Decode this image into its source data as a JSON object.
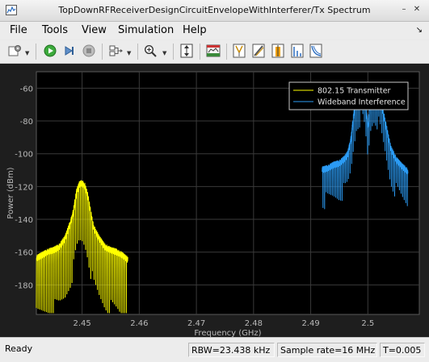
{
  "window": {
    "title": "TopDownRFReceiverDesignCircuitEnvelopeWithInterferer/Tx Spectrum",
    "icon": "scope-window-icon"
  },
  "menu": {
    "items": [
      {
        "label": "File"
      },
      {
        "label": "Tools"
      },
      {
        "label": "View"
      },
      {
        "label": "Simulation"
      },
      {
        "label": "Help"
      }
    ]
  },
  "toolbar": {
    "buttons": [
      "settings-icon",
      "run-icon",
      "step-forward-icon",
      "stop-icon",
      "signal-select-icon",
      "zoom-icon",
      "scale-axes-icon",
      "spectrum-settings-icon",
      "cursor-icon",
      "peak-finder-icon",
      "channel-measurements-icon",
      "distortion-measurements-icon",
      "ccdf-icon"
    ]
  },
  "status": {
    "ready": "Ready",
    "rbw": "RBW=23.438 kHz",
    "sample_rate": "Sample rate=16 MHz",
    "time": "T=0.005"
  },
  "colors": {
    "plot_bg": "#000000",
    "figure_bg": "#1e1e1e",
    "axis_text": "#b9b9b9",
    "grid": "#3a3a3a",
    "series_tx": "#ffff00",
    "series_wb": "#2b9bf4"
  },
  "chart_data": {
    "type": "line",
    "title": "",
    "xlabel": "Frequency (GHz)",
    "ylabel": "Power (dBm)",
    "xlim": [
      2.442,
      2.509
    ],
    "ylim": [
      -198,
      -50
    ],
    "xticks": [
      2.45,
      2.46,
      2.47,
      2.48,
      2.49,
      2.5
    ],
    "xtick_labels": [
      "2.45",
      "2.46",
      "2.47",
      "2.48",
      "2.49",
      "2.5"
    ],
    "yticks": [
      -60,
      -80,
      -100,
      -120,
      -140,
      -160,
      -180
    ],
    "ytick_labels": [
      "-60",
      "-80",
      "-100",
      "-120",
      "-140",
      "-160",
      "-180"
    ],
    "grid": true,
    "legend_position": "top-right",
    "series": [
      {
        "name": "802.15 Transmitter",
        "color": "#ffff00",
        "x": [
          2.442,
          2.443,
          2.444,
          2.445,
          2.446,
          2.447,
          2.448,
          2.4485,
          2.449,
          2.4495,
          2.45,
          2.4505,
          2.451,
          2.4515,
          2.452,
          2.453,
          2.454,
          2.455,
          2.456,
          2.457,
          2.458
        ],
        "values": [
          -162,
          -160,
          -158,
          -157,
          -155,
          -150,
          -140,
          -133,
          -122,
          -117,
          -116,
          -118,
          -124,
          -134,
          -143,
          -150,
          -155,
          -157,
          -158,
          -160,
          -163
        ]
      },
      {
        "name": "Wideband Interference",
        "color": "#2b9bf4",
        "x": [
          2.492,
          2.493,
          2.494,
          2.495,
          2.496,
          2.4965,
          2.497,
          2.4975,
          2.498,
          2.4985,
          2.499,
          2.4995,
          2.5,
          2.5005,
          2.501,
          2.5015,
          2.502,
          2.503,
          2.504,
          2.505,
          2.506,
          2.507
        ],
        "values": [
          -108,
          -107,
          -105,
          -104,
          -101,
          -98,
          -90,
          -75,
          -62,
          -58,
          -57,
          -64,
          -82,
          -64,
          -57,
          -58,
          -62,
          -78,
          -95,
          -102,
          -106,
          -109
        ]
      }
    ]
  }
}
